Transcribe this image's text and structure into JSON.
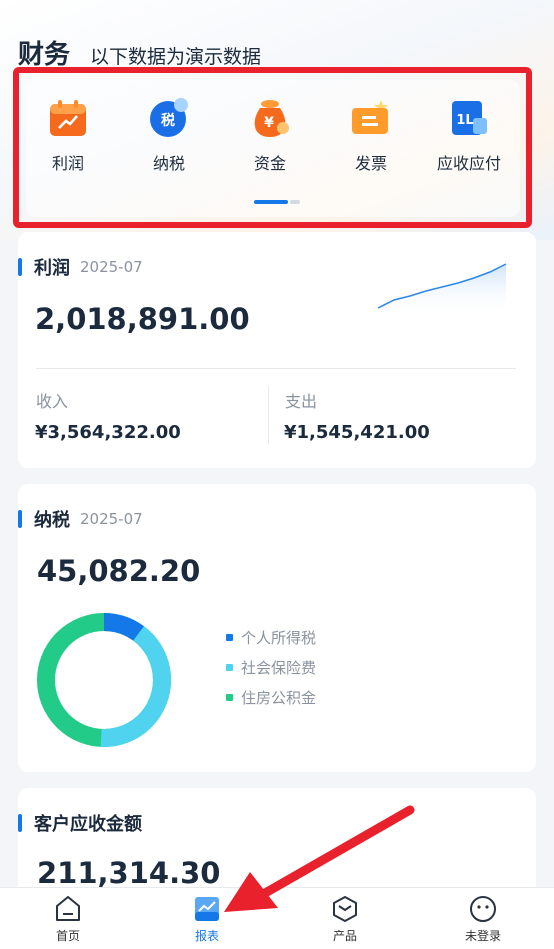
{
  "header": {
    "title": "财务",
    "subtitle": "以下数据为演示数据"
  },
  "menu": {
    "items": [
      {
        "label": "利润"
      },
      {
        "label": "纳税",
        "icon_text": "税"
      },
      {
        "label": "资金",
        "icon_text": "¥"
      },
      {
        "label": "发票"
      },
      {
        "label": "应收应付",
        "icon_text": "1L"
      }
    ]
  },
  "profit": {
    "name": "利润",
    "period": "2025-07",
    "value": "2,018,891.00",
    "income_label": "收入",
    "income_value": "¥3,564,322.00",
    "expense_label": "支出",
    "expense_value": "¥1,545,421.00"
  },
  "tax": {
    "name": "纳税",
    "period": "2025-07",
    "value": "45,082.20",
    "legend": [
      {
        "label": "个人所得税",
        "color": "#1478e8"
      },
      {
        "label": "社会保险费",
        "color": "#4fd3ee"
      },
      {
        "label": "住房公积金",
        "color": "#22cc88"
      }
    ]
  },
  "receivable": {
    "name": "客户应收金额",
    "value": "211,314.30"
  },
  "bottom_nav": {
    "items": [
      {
        "label": "首页"
      },
      {
        "label": "报表"
      },
      {
        "label": "产品"
      },
      {
        "label": "未登录"
      }
    ]
  },
  "colors": {
    "accent": "#1478e8",
    "highlight": "#e8212d"
  }
}
